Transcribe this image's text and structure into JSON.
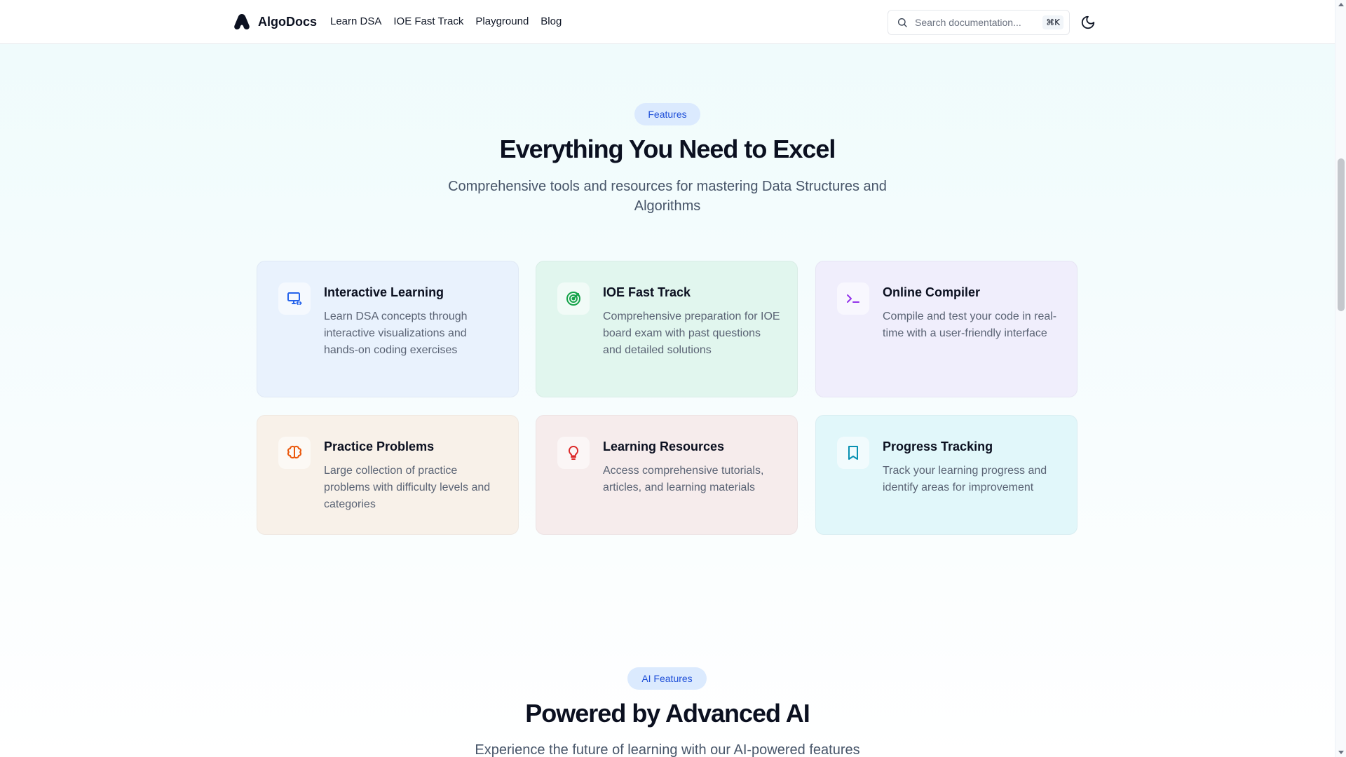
{
  "header": {
    "brand": "AlgoDocs",
    "nav": [
      "Learn DSA",
      "IOE Fast Track",
      "Playground",
      "Blog"
    ],
    "search_placeholder": "Search documentation...",
    "search_shortcut": "⌘K",
    "theme_icon": "moon-icon"
  },
  "features": {
    "badge": "Features",
    "heading": "Everything You Need to Excel",
    "subtitle": "Comprehensive tools and resources for mastering Data Structures and Algorithms",
    "cards": [
      {
        "title": "Interactive Learning",
        "desc": "Learn DSA concepts through interactive visualizations and hands-on coding exercises",
        "icon": "monitor-code-icon",
        "accent": "#2563eb"
      },
      {
        "title": "IOE Fast Track",
        "desc": "Comprehensive preparation for IOE board exam with past questions and detailed solutions",
        "icon": "target-icon",
        "accent": "#16a34a"
      },
      {
        "title": "Online Compiler",
        "desc": "Compile and test your code in real-time with a user-friendly interface",
        "icon": "terminal-icon",
        "accent": "#9333ea"
      },
      {
        "title": "Practice Problems",
        "desc": "Large collection of practice problems with difficulty levels and categories",
        "icon": "brain-icon",
        "accent": "#ea580c"
      },
      {
        "title": "Learning Resources",
        "desc": "Access comprehensive tutorials, articles, and learning materials",
        "icon": "lightbulb-icon",
        "accent": "#dc2626"
      },
      {
        "title": "Progress Tracking",
        "desc": "Track your learning progress and identify areas for improvement",
        "icon": "bookmark-icon",
        "accent": "#0891b2"
      }
    ]
  },
  "ai": {
    "badge": "AI Features",
    "heading": "Powered by Advanced AI",
    "subtitle": "Experience the future of learning with our AI-powered features"
  }
}
